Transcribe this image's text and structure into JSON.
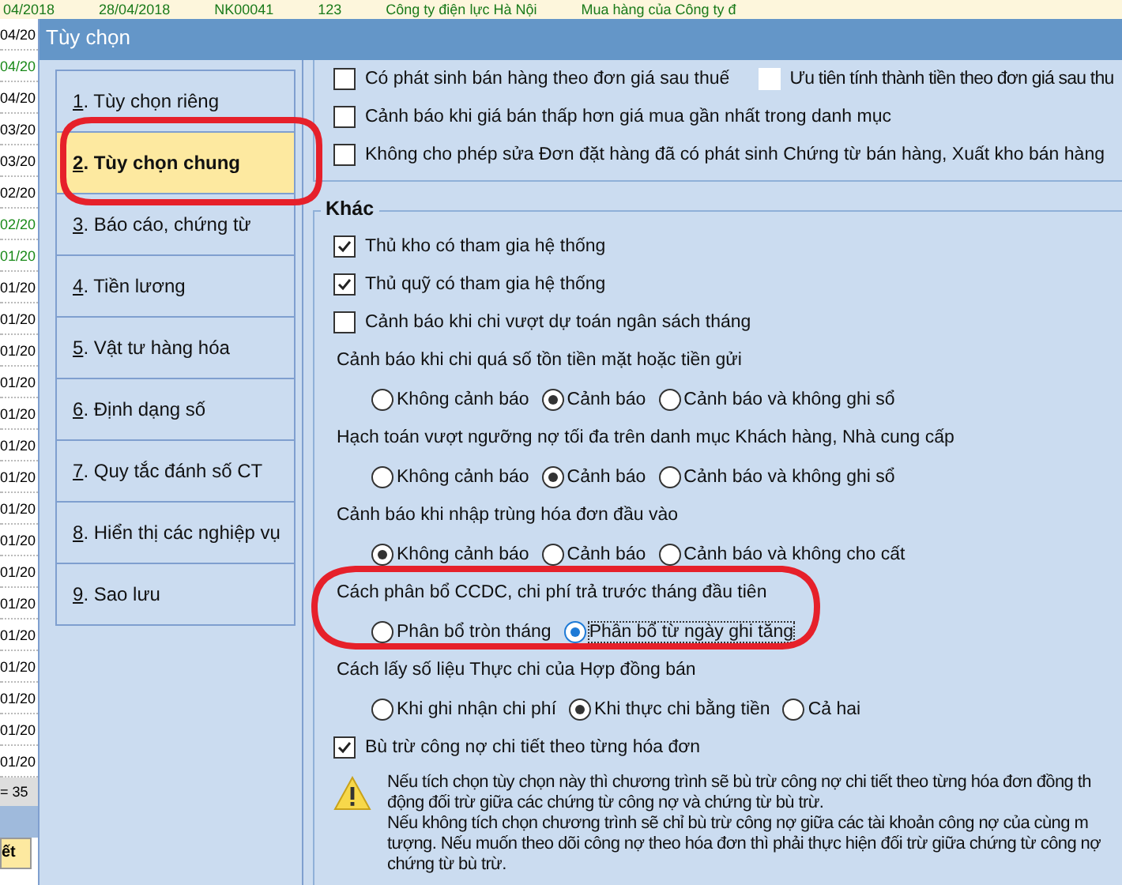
{
  "background_table": {
    "top_row": [
      "04/2018",
      "28/04/2018",
      "NK00041",
      "123",
      "Công ty điện lực Hà Nội",
      "Mua hàng của Công ty đ"
    ],
    "date_cells": [
      {
        "text": "04/20",
        "color": "#000000"
      },
      {
        "text": "04/20",
        "color": "#1a8a1a"
      },
      {
        "text": "04/20",
        "color": "#000000"
      },
      {
        "text": "03/20",
        "color": "#000000"
      },
      {
        "text": "03/20",
        "color": "#000000"
      },
      {
        "text": "02/20",
        "color": "#000000"
      },
      {
        "text": "02/20",
        "color": "#1a8a1a"
      },
      {
        "text": "01/20",
        "color": "#1a8a1a"
      },
      {
        "text": "01/20",
        "color": "#000000"
      },
      {
        "text": "01/20",
        "color": "#000000"
      },
      {
        "text": "01/20",
        "color": "#000000"
      },
      {
        "text": "01/20",
        "color": "#000000"
      },
      {
        "text": "01/20",
        "color": "#000000"
      },
      {
        "text": "01/20",
        "color": "#000000"
      },
      {
        "text": "01/20",
        "color": "#000000"
      },
      {
        "text": "01/20",
        "color": "#000000"
      },
      {
        "text": "01/20",
        "color": "#000000"
      },
      {
        "text": "01/20",
        "color": "#000000"
      },
      {
        "text": "01/20",
        "color": "#000000"
      },
      {
        "text": "01/20",
        "color": "#000000"
      },
      {
        "text": "01/20",
        "color": "#000000"
      },
      {
        "text": "01/20",
        "color": "#000000"
      },
      {
        "text": "01/20",
        "color": "#000000"
      },
      {
        "text": "01/20",
        "color": "#000000"
      }
    ],
    "footer": "= 35",
    "tab": "ết"
  },
  "dialog": {
    "title": "Tùy chọn",
    "nav": [
      {
        "key": "1",
        "label": ". Tùy chọn riêng",
        "selected": false
      },
      {
        "key": "2",
        "label": ". Tùy chọn chung",
        "selected": true
      },
      {
        "key": "3",
        "label": ". Báo cáo, chứng từ",
        "selected": false
      },
      {
        "key": "4",
        "label": ". Tiền lương",
        "selected": false
      },
      {
        "key": "5",
        "label": ". Vật tư hàng hóa",
        "selected": false
      },
      {
        "key": "6",
        "label": ". Định dạng số",
        "selected": false
      },
      {
        "key": "7",
        "label": ". Quy tắc đánh số CT",
        "selected": false
      },
      {
        "key": "8",
        "label": ". Hiển thị các nghiệp vụ",
        "selected": false
      },
      {
        "key": "9",
        "label": ". Sao lưu",
        "selected": false
      }
    ],
    "top_group": [
      [
        {
          "label": "Có phát sinh bán hàng theo đơn giá sau thuế",
          "checked": false,
          "disabled": false
        },
        {
          "label": "Ưu tiên tính thành tiền theo đơn giá sau thu",
          "checked": false,
          "disabled": true
        }
      ],
      [
        {
          "label": "Cảnh báo khi giá bán thấp hơn giá mua gần nhất trong danh mục",
          "checked": false,
          "disabled": false
        }
      ],
      [
        {
          "label": "Không cho phép sửa Đơn đặt hàng đã có phát sinh Chứng từ bán hàng, Xuất kho bán hàng",
          "checked": false,
          "disabled": false
        }
      ]
    ],
    "other_group": {
      "title": "Khác",
      "items": [
        {
          "kind": "checkbox",
          "label": "Thủ kho có tham gia hệ thống",
          "checked": true
        },
        {
          "kind": "checkbox",
          "label": "Thủ quỹ có tham gia hệ thống",
          "checked": true
        },
        {
          "kind": "checkbox",
          "label": "Cảnh báo khi chi vượt dự toán ngân sách tháng",
          "checked": false
        },
        {
          "kind": "radio",
          "label": "Cảnh báo khi chi quá số tồn tiền mặt hoặc tiền gửi",
          "options": [
            {
              "label": "Không cảnh báo",
              "selected": false
            },
            {
              "label": "Cảnh báo",
              "selected": true
            },
            {
              "label": "Cảnh báo và không ghi sổ",
              "selected": false
            }
          ]
        },
        {
          "kind": "radio",
          "label": "Hạch toán vượt ngưỡng nợ tối đa trên danh mục Khách hàng, Nhà cung cấp",
          "options": [
            {
              "label": "Không cảnh báo",
              "selected": false
            },
            {
              "label": "Cảnh báo",
              "selected": true
            },
            {
              "label": "Cảnh báo và không ghi sổ",
              "selected": false
            }
          ]
        },
        {
          "kind": "radio",
          "label": "Cảnh báo khi nhập trùng hóa đơn đầu vào",
          "options": [
            {
              "label": "Không cảnh báo",
              "selected": true
            },
            {
              "label": "Cảnh báo",
              "selected": false
            },
            {
              "label": "Cảnh báo và không cho cất",
              "selected": false
            }
          ]
        },
        {
          "kind": "radio",
          "label": "Cách phân bổ CCDC, chi phí trả trước tháng đầu tiên",
          "options": [
            {
              "label": "Phân bổ tròn tháng",
              "selected": false,
              "focused": false
            },
            {
              "label": "Phân bổ từ ngày ghi tăng",
              "selected": true,
              "focused": true
            }
          ]
        },
        {
          "kind": "radio",
          "label": "Cách lấy số liệu Thực chi của Hợp đồng bán",
          "options": [
            {
              "label": "Khi ghi nhận chi phí",
              "selected": false
            },
            {
              "label": "Khi thực chi bằng tiền",
              "selected": true
            },
            {
              "label": "Cả hai",
              "selected": false
            }
          ]
        },
        {
          "kind": "checkbox",
          "label": "Bù trừ công nợ chi tiết theo từng hóa đơn",
          "checked": true
        },
        {
          "kind": "note",
          "lines": [
            "Nếu tích chọn tùy chọn này thì chương trình sẽ bù trừ công nợ chi tiết theo từng hóa đơn đồng th",
            "động đối trừ giữa các chứng từ công nợ và chứng từ bù trừ.",
            "Nếu không tích chọn chương trình sẽ chỉ bù trừ công nợ giữa các tài khoản công nợ của cùng m",
            "tượng. Nếu muốn theo dõi công nợ theo hóa đơn thì phải thực hiện đối trừ giữa chứng từ công nợ",
            "chứng từ bù trừ."
          ]
        }
      ]
    }
  }
}
